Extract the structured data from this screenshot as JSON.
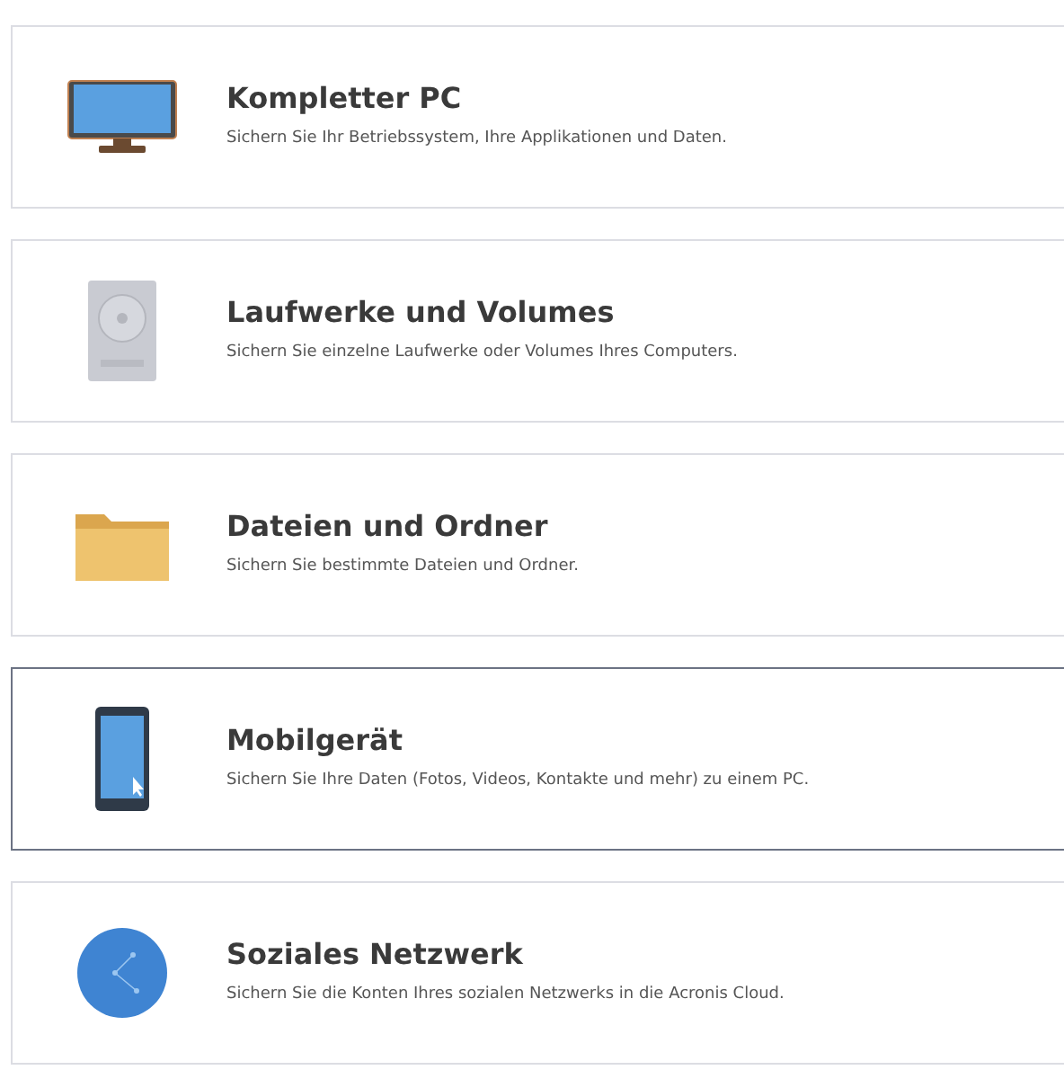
{
  "options": [
    {
      "kind": "monitor",
      "title": "Kompletter PC",
      "description": "Sichern Sie Ihr Betriebssystem, Ihre Applikationen und Daten.",
      "selected": false
    },
    {
      "kind": "drive",
      "title": "Laufwerke und Volumes",
      "description": "Sichern Sie einzelne Laufwerke oder Volumes Ihres Computers.",
      "selected": false
    },
    {
      "kind": "folder",
      "title": "Dateien und Ordner",
      "description": "Sichern Sie bestimmte Dateien und Ordner.",
      "selected": false
    },
    {
      "kind": "phone",
      "title": "Mobilgerät",
      "description": "Sichern Sie Ihre Daten (Fotos, Videos, Kontakte und mehr) zu einem PC.",
      "selected": true
    },
    {
      "kind": "globe",
      "title": "Soziales Netzwerk",
      "description": "Sichern Sie die Konten Ihres sozialen Netzwerks in die Acronis Cloud.",
      "selected": false
    }
  ]
}
